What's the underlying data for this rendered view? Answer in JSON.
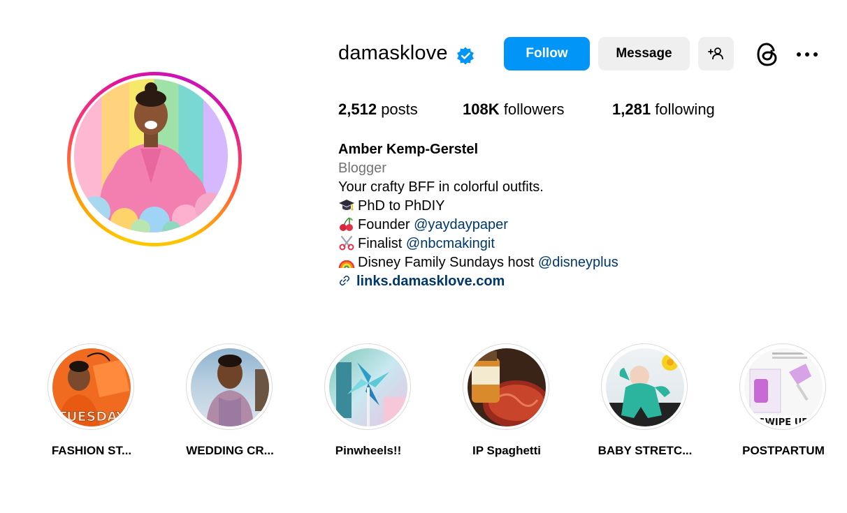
{
  "profile": {
    "username": "damasklove",
    "follow_label": "Follow",
    "message_label": "Message"
  },
  "stats": {
    "posts_count": "2,512",
    "posts_label": "posts",
    "followers_count": "108K",
    "followers_label": "followers",
    "following_count": "1,281",
    "following_label": "following"
  },
  "bio": {
    "name": "Amber Kemp-Gerstel",
    "category": "Blogger",
    "line1": "Your crafty BFF in colorful outfits.",
    "line2": "PhD to PhDIY",
    "line3_text": "Founder ",
    "line3_mention": "@yaydaypaper",
    "line4_text": "Finalist ",
    "line4_mention": "@nbcmakingit",
    "line5_text": "Disney Family Sundays host ",
    "line5_mention": "@disneyplus",
    "link": "links.damasklove.com"
  },
  "highlights": [
    {
      "label": "FASHION ST...",
      "overlay": "TUESDAY"
    },
    {
      "label": "WEDDING CR..."
    },
    {
      "label": "Pinwheels!!"
    },
    {
      "label": "IP Spaghetti"
    },
    {
      "label": "BABY STRETC..."
    },
    {
      "label": "POSTPARTUM",
      "overlay": "SWIPE UP"
    }
  ],
  "colors": {
    "follow_button": "#0095f6",
    "secondary_button": "#efefef",
    "verified_badge": "#0095f6",
    "mention_link": "#00376b",
    "category_text": "#737373"
  },
  "icons": [
    "verified-badge-icon",
    "add-person-icon",
    "threads-icon",
    "more-options-icon",
    "link-icon",
    "graduation-cap-emoji",
    "cherries-emoji",
    "scissors-emoji",
    "rainbow-emoji"
  ]
}
